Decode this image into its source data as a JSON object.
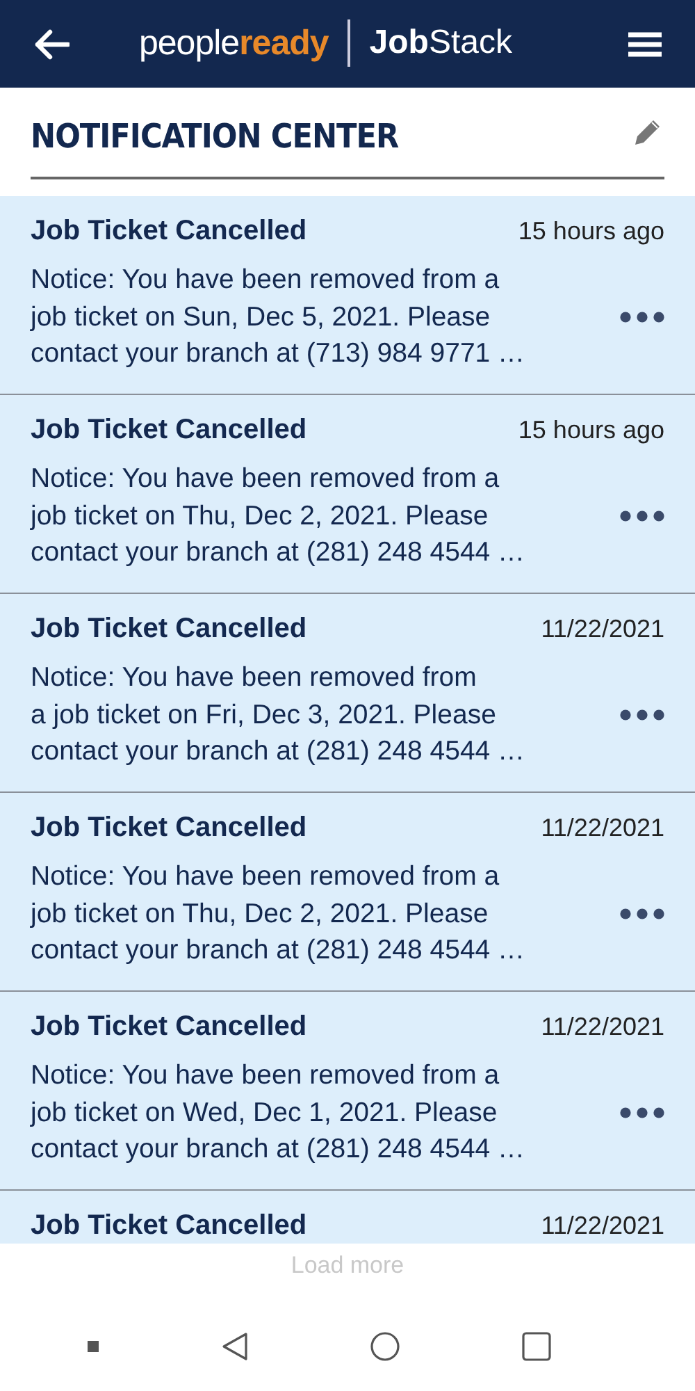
{
  "header": {
    "logo": {
      "part1": "people",
      "part2": "ready",
      "part3": "Job",
      "part4": "Stack"
    }
  },
  "page_title": "NOTIFICATION CENTER",
  "notifications": [
    {
      "title": "Job Ticket Cancelled",
      "time": "15 hours ago",
      "lines": [
        "Notice: You have been removed from a",
        "job ticket on Sun, Dec 5, 2021. Please",
        "contact your branch at (713) 984 9771 …"
      ]
    },
    {
      "title": "Job Ticket Cancelled",
      "time": "15 hours ago",
      "lines": [
        "Notice: You have been removed from a",
        "job ticket on Thu, Dec 2, 2021. Please",
        "contact your branch at (281) 248 4544 …"
      ]
    },
    {
      "title": "Job Ticket Cancelled",
      "time": "11/22/2021",
      "lines": [
        "Notice: You have been removed from",
        "a job ticket on Fri, Dec 3, 2021. Please",
        "contact your branch at (281) 248 4544 …"
      ]
    },
    {
      "title": "Job Ticket Cancelled",
      "time": "11/22/2021",
      "lines": [
        "Notice: You have been removed from a",
        "job ticket on Thu, Dec 2, 2021. Please",
        "contact your branch at (281) 248 4544 …"
      ]
    },
    {
      "title": "Job Ticket Cancelled",
      "time": "11/22/2021",
      "lines": [
        "Notice: You have been removed from a",
        "job ticket on Wed, Dec 1, 2021. Please",
        "contact your branch at (281) 248 4544 …"
      ]
    },
    {
      "title": "Job Ticket Cancelled",
      "time": "11/22/2021"
    }
  ],
  "load_more": "Load more"
}
